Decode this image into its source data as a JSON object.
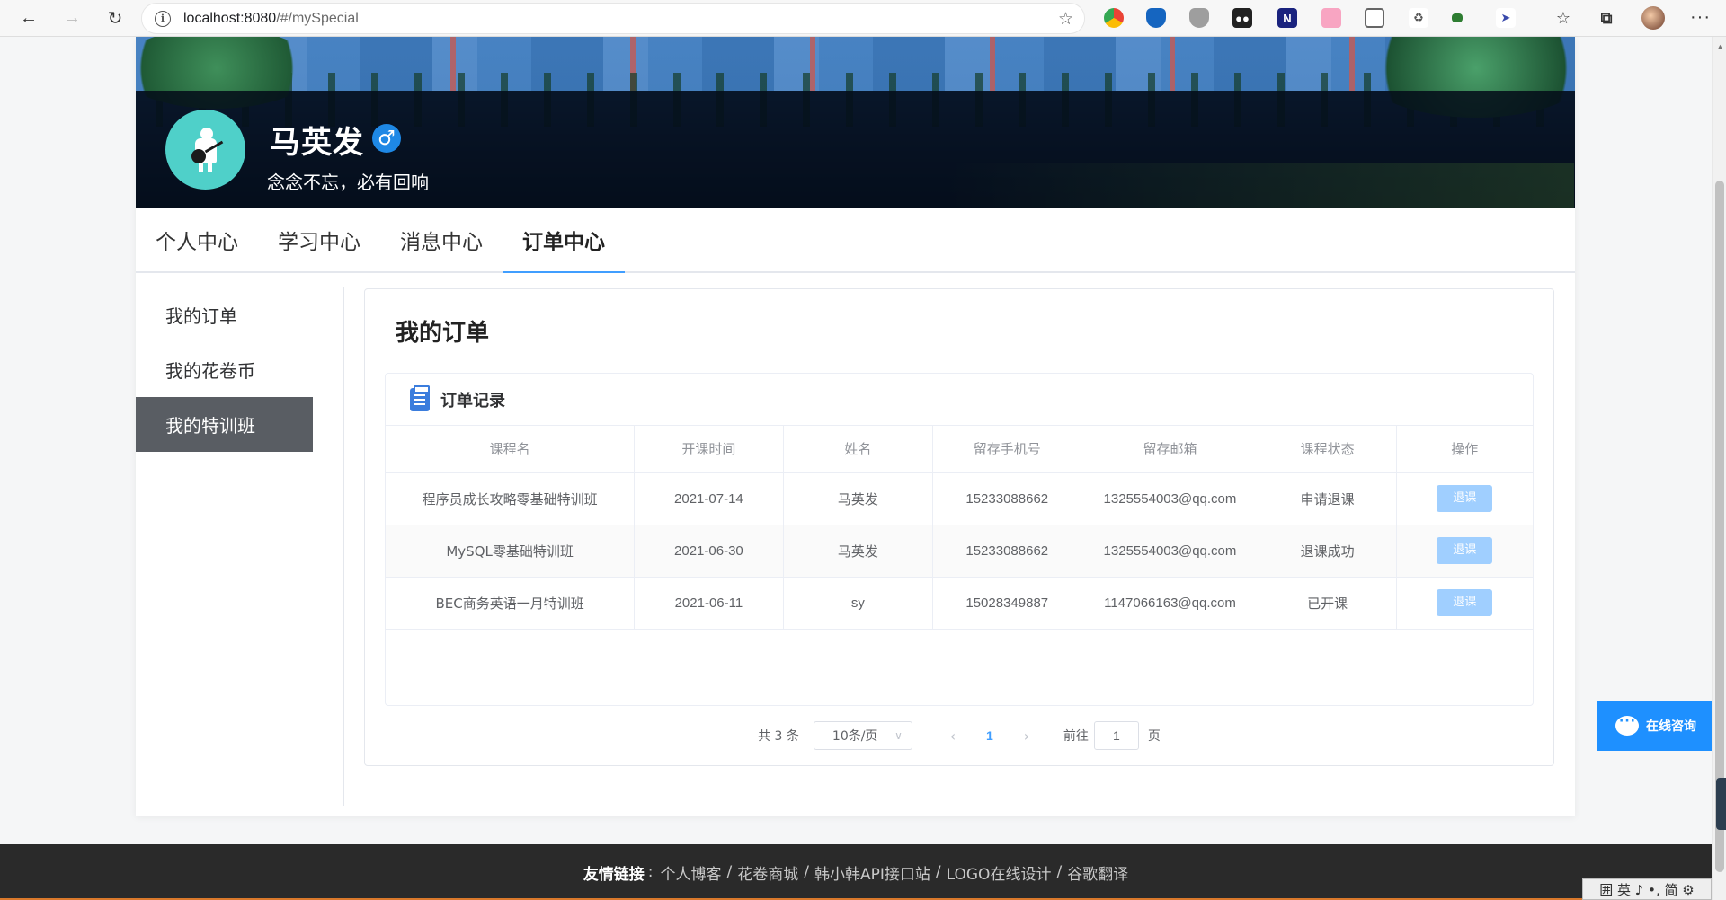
{
  "browser": {
    "url_host": "localhost:8080",
    "url_path": "/#/mySpecial"
  },
  "profile": {
    "name": "马英发",
    "gender_symbol": "♂",
    "motto": "念念不忘，必有回响"
  },
  "tabs": [
    {
      "label": "个人中心",
      "active": false
    },
    {
      "label": "学习中心",
      "active": false
    },
    {
      "label": "消息中心",
      "active": false
    },
    {
      "label": "订单中心",
      "active": true
    }
  ],
  "sidebar": {
    "items": [
      {
        "label": "我的订单",
        "active": false
      },
      {
        "label": "我的花卷币",
        "active": false
      },
      {
        "label": "我的特训班",
        "active": true
      }
    ]
  },
  "main": {
    "title": "我的订单",
    "card_title": "订单记录",
    "columns": [
      "课程名",
      "开课时间",
      "姓名",
      "留存手机号",
      "留存邮箱",
      "课程状态",
      "操作"
    ],
    "rows": [
      {
        "course": "程序员成长攻略零基础特训班",
        "date": "2021-07-14",
        "name": "马英发",
        "phone": "15233088662",
        "email": "1325554003@qq.com",
        "status": "申请退课",
        "action": "退课"
      },
      {
        "course": "MySQL零基础特训班",
        "date": "2021-06-30",
        "name": "马英发",
        "phone": "15233088662",
        "email": "1325554003@qq.com",
        "status": "退课成功",
        "action": "退课"
      },
      {
        "course": "BEC商务英语一月特训班",
        "date": "2021-06-11",
        "name": "sy",
        "phone": "15028349887",
        "email": "1147066163@qq.com",
        "status": "已开课",
        "action": "退课"
      }
    ]
  },
  "pagination": {
    "total": "共 3 条",
    "page_size": "10条/页",
    "current_page": "1",
    "goto_label": "前往",
    "goto_value": "1",
    "page_unit": "页"
  },
  "chat": {
    "label": "在线咨询"
  },
  "footer": {
    "label": "友情链接",
    "links": [
      "个人博客",
      "花卷商城",
      "韩小韩API接口站",
      "LOGO在线设计",
      "谷歌翻译"
    ]
  },
  "ime": {
    "text": "囲 英 ♪ •, 简 ⚙"
  }
}
